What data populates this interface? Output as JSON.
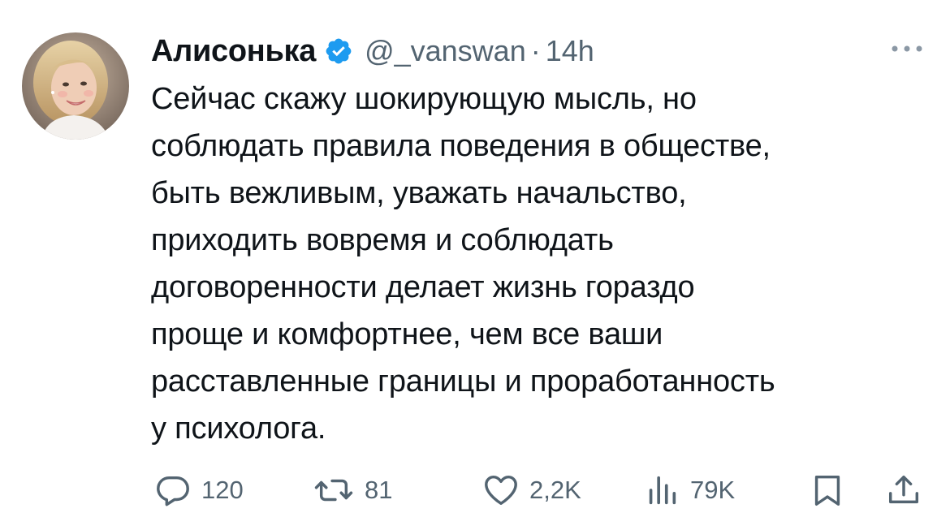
{
  "tweet": {
    "display_name": "Алисонька",
    "handle": "@_vanswan",
    "separator": "·",
    "time": "14h",
    "text": "Сейчас скажу шокирующую мысль, но\nсоблюдать правила поведения в обществе,\nбыть вежливым, уважать начальство,\nприходить вовремя и соблюдать\nдоговоренности делает жизнь гораздо\nпроще и комфортнее, чем все ваши\nрасставленные границы и проработанность\nу психолога."
  },
  "actions": {
    "replies": "120",
    "retweets": "81",
    "likes": "2,2K",
    "views": "79K"
  },
  "icons": {
    "verified": "verified-badge-icon",
    "more": "more-dots-icon",
    "reply": "reply-icon",
    "retweet": "retweet-icon",
    "like": "heart-icon",
    "views": "views-icon",
    "bookmark": "bookmark-icon",
    "share": "share-icon"
  },
  "colors": {
    "text": "#0f1419",
    "secondary": "#536471",
    "verified": "#1d9bf0"
  }
}
